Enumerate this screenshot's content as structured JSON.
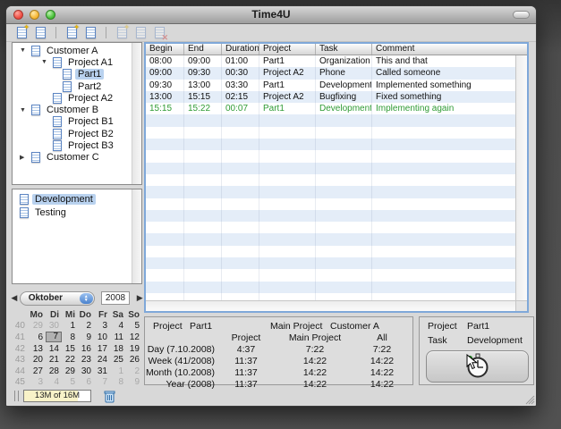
{
  "window": {
    "title": "Time4U"
  },
  "toolbar": {
    "icons": [
      {
        "id": "new-customer",
        "badge": "star",
        "disabled": false
      },
      {
        "id": "customer",
        "badge": "none",
        "disabled": false
      },
      {
        "separator": true
      },
      {
        "id": "new-project",
        "badge": "star",
        "disabled": false
      },
      {
        "id": "project",
        "badge": "none",
        "disabled": false
      },
      {
        "separator": true
      },
      {
        "id": "new-entry",
        "badge": "star",
        "disabled": true
      },
      {
        "id": "edit-entry",
        "badge": "none",
        "disabled": true
      },
      {
        "id": "delete-entry",
        "badge": "x",
        "disabled": true
      }
    ]
  },
  "tree": {
    "items": [
      {
        "label": "Customer A",
        "level": 0,
        "expander": "open",
        "selected": false
      },
      {
        "label": "Project A1",
        "level": 1,
        "expander": "open",
        "selected": false
      },
      {
        "label": "Part1",
        "level": 2,
        "expander": null,
        "selected": true
      },
      {
        "label": "Part2",
        "level": 2,
        "expander": null,
        "selected": false
      },
      {
        "label": "Project A2",
        "level": 1,
        "expander": null,
        "selected": false
      },
      {
        "label": "Customer B",
        "level": 0,
        "expander": "open",
        "selected": false
      },
      {
        "label": "Project B1",
        "level": 1,
        "expander": null,
        "selected": false
      },
      {
        "label": "Project B2",
        "level": 1,
        "expander": null,
        "selected": false
      },
      {
        "label": "Project B3",
        "level": 1,
        "expander": null,
        "selected": false
      },
      {
        "label": "Customer C",
        "level": 0,
        "expander": "closed",
        "selected": false
      }
    ]
  },
  "tasks": {
    "items": [
      {
        "label": "Development",
        "selected": true
      },
      {
        "label": "Testing",
        "selected": false
      }
    ]
  },
  "calendar": {
    "month": "Oktober",
    "year": "2008",
    "day_headers": [
      "Mo",
      "Di",
      "Mi",
      "Do",
      "Fr",
      "Sa",
      "So"
    ],
    "weeks": [
      {
        "num": "40",
        "days": [
          {
            "d": "29",
            "muted": true
          },
          {
            "d": "30",
            "muted": true
          },
          {
            "d": "1"
          },
          {
            "d": "2"
          },
          {
            "d": "3"
          },
          {
            "d": "4"
          },
          {
            "d": "5"
          }
        ]
      },
      {
        "num": "41",
        "days": [
          {
            "d": "6"
          },
          {
            "d": "7",
            "selected": true
          },
          {
            "d": "8"
          },
          {
            "d": "9"
          },
          {
            "d": "10"
          },
          {
            "d": "11"
          },
          {
            "d": "12"
          }
        ]
      },
      {
        "num": "42",
        "days": [
          {
            "d": "13"
          },
          {
            "d": "14"
          },
          {
            "d": "15"
          },
          {
            "d": "16"
          },
          {
            "d": "17"
          },
          {
            "d": "18"
          },
          {
            "d": "19"
          }
        ]
      },
      {
        "num": "43",
        "days": [
          {
            "d": "20"
          },
          {
            "d": "21"
          },
          {
            "d": "22"
          },
          {
            "d": "23"
          },
          {
            "d": "24"
          },
          {
            "d": "25"
          },
          {
            "d": "26"
          }
        ]
      },
      {
        "num": "44",
        "days": [
          {
            "d": "27"
          },
          {
            "d": "28"
          },
          {
            "d": "29"
          },
          {
            "d": "30"
          },
          {
            "d": "31"
          },
          {
            "d": "1",
            "muted": true
          },
          {
            "d": "2",
            "muted": true
          }
        ]
      },
      {
        "num": "45",
        "days": [
          {
            "d": "3",
            "muted": true
          },
          {
            "d": "4",
            "muted": true
          },
          {
            "d": "5",
            "muted": true
          },
          {
            "d": "6",
            "muted": true
          },
          {
            "d": "7",
            "muted": true
          },
          {
            "d": "8",
            "muted": true
          },
          {
            "d": "9",
            "muted": true
          }
        ]
      }
    ]
  },
  "status": {
    "memory": "13M of 16M"
  },
  "table": {
    "columns": [
      "Begin",
      "End",
      "Duration",
      "Project",
      "Task",
      "Comment"
    ],
    "rows": [
      {
        "cells": [
          "08:00",
          "09:00",
          "01:00",
          "Part1",
          "Organization",
          "This and that"
        ],
        "active": false
      },
      {
        "cells": [
          "09:00",
          "09:30",
          "00:30",
          "Project A2",
          "Phone",
          "Called someone"
        ],
        "active": false
      },
      {
        "cells": [
          "09:30",
          "13:00",
          "03:30",
          "Part1",
          "Development",
          "Implemented something"
        ],
        "active": false
      },
      {
        "cells": [
          "13:00",
          "15:15",
          "02:15",
          "Project A2",
          "Bugfixing",
          "Fixed something"
        ],
        "active": false
      },
      {
        "cells": [
          "15:15",
          "15:22",
          "00:07",
          "Part1",
          "Development",
          "Implementing again"
        ],
        "active": true
      }
    ]
  },
  "summary": {
    "project_label": "Project",
    "project_value": "Part1",
    "main_project_label": "Main Project",
    "main_project_value": "Customer A",
    "columns": [
      "Project",
      "Main Project",
      "All"
    ],
    "rows": [
      {
        "label": "Day (7.10.2008)",
        "values": [
          "4:37",
          "7:22",
          "7:22"
        ]
      },
      {
        "label": "Week (41/2008)",
        "values": [
          "11:37",
          "14:22",
          "14:22"
        ]
      },
      {
        "label": "Month (10.2008)",
        "values": [
          "11:37",
          "14:22",
          "14:22"
        ]
      },
      {
        "label": "Year (2008)",
        "values": [
          "11:37",
          "14:22",
          "14:22"
        ]
      }
    ]
  },
  "timer": {
    "project_label": "Project",
    "project_value": "Part1",
    "task_label": "Task",
    "task_value": "Development"
  },
  "colors": {
    "selection": "#b9d2ef",
    "stripe": "#e4edf8",
    "active_row_text": "#2f9b34",
    "focus_ring": "#7fa8d9"
  }
}
